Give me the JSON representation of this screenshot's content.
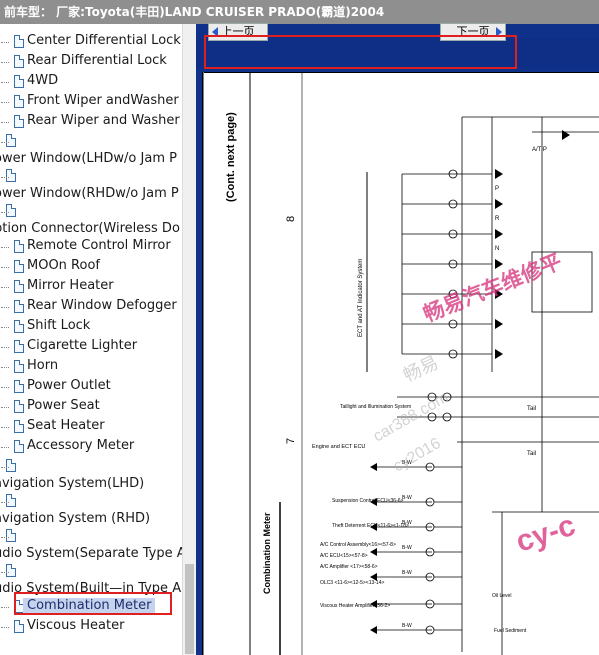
{
  "window": {
    "title": "前车型：  厂家:Toyota(丰田)LAND CRUISER PRADO(霸道)2004"
  },
  "nav": {
    "prev_label": "上一页",
    "next_label": "下一页"
  },
  "sidebar": {
    "items": [
      {
        "label": "Center Differential Lock",
        "type": "child"
      },
      {
        "label": "Rear Differential Lock",
        "type": "child"
      },
      {
        "label": "4WD",
        "type": "child"
      },
      {
        "label": "Front Wiper andWasher",
        "type": "child"
      },
      {
        "label": "Rear Wiper and Washer",
        "type": "child"
      },
      {
        "label": "",
        "type": "iconrow"
      },
      {
        "label": "ower Window(LHDw/o Jam P",
        "type": "top"
      },
      {
        "label": "",
        "type": "iconrow"
      },
      {
        "label": "ower Window(RHDw/o Jam P",
        "type": "top"
      },
      {
        "label": "",
        "type": "iconrow"
      },
      {
        "label": "ption Connector(Wireless Do",
        "type": "top"
      },
      {
        "label": "Remote Control Mirror",
        "type": "child"
      },
      {
        "label": "MOOn Roof",
        "type": "child"
      },
      {
        "label": "Mirror Heater",
        "type": "child"
      },
      {
        "label": "Rear Window Defogger",
        "type": "child"
      },
      {
        "label": "Shift Lock",
        "type": "child"
      },
      {
        "label": "Cigarette Lighter",
        "type": "child"
      },
      {
        "label": "Horn",
        "type": "child"
      },
      {
        "label": "Power Outlet",
        "type": "child"
      },
      {
        "label": "Power Seat",
        "type": "child"
      },
      {
        "label": "Seat Heater",
        "type": "child"
      },
      {
        "label": "Accessory Meter",
        "type": "child"
      },
      {
        "label": "",
        "type": "iconrow"
      },
      {
        "label": "avigation System(LHD)",
        "type": "top"
      },
      {
        "label": "",
        "type": "iconrow"
      },
      {
        "label": "avigation System (RHD)",
        "type": "top"
      },
      {
        "label": "",
        "type": "iconrow"
      },
      {
        "label": "udio System(Separate Type A",
        "type": "top"
      },
      {
        "label": "",
        "type": "iconrow"
      },
      {
        "label": "udio System(Built—in Type A",
        "type": "top"
      },
      {
        "label": "Combination Meter",
        "type": "child",
        "selected": true
      },
      {
        "label": "Viscous Heater",
        "type": "child"
      }
    ]
  },
  "diagram": {
    "header": "(Cont. next page)",
    "column_numbers": [
      "8",
      "7"
    ],
    "section_label": "Combination Meter",
    "left_labels": [
      "ECT and AT Indicator System",
      "Taillight and Illumination System",
      "Engine and ECT ECU",
      "Suspension Control ECU<36-6>",
      "Theft Deterrent ECU<11-6><1-18>",
      "A/C Control Assembly<16><57-8>",
      "A/C ECU<15><57-8>",
      "A/C Amplifier <17><58-6>",
      "OLC3 <11-6><12-5><13-14>",
      "Viscous Heater Amplifier<56-2>"
    ],
    "wire_labels": [
      "B-W",
      "B-W",
      "B-W",
      "B-W",
      "B-W",
      "B-W"
    ],
    "right_labels": [
      "A/T P",
      "P",
      "R",
      "N",
      "Tail",
      "Tail",
      "Oil Level",
      "Fuel Sediment"
    ],
    "watermarks": [
      "畅易汽车维修平",
      "畅易",
      "car388.com",
      "cy2016",
      "cy-c"
    ]
  },
  "colors": {
    "titlebar": "#8f8f8f",
    "pane": "#10318a",
    "highlight": "#e02020",
    "selection": "#c6d3ee"
  }
}
